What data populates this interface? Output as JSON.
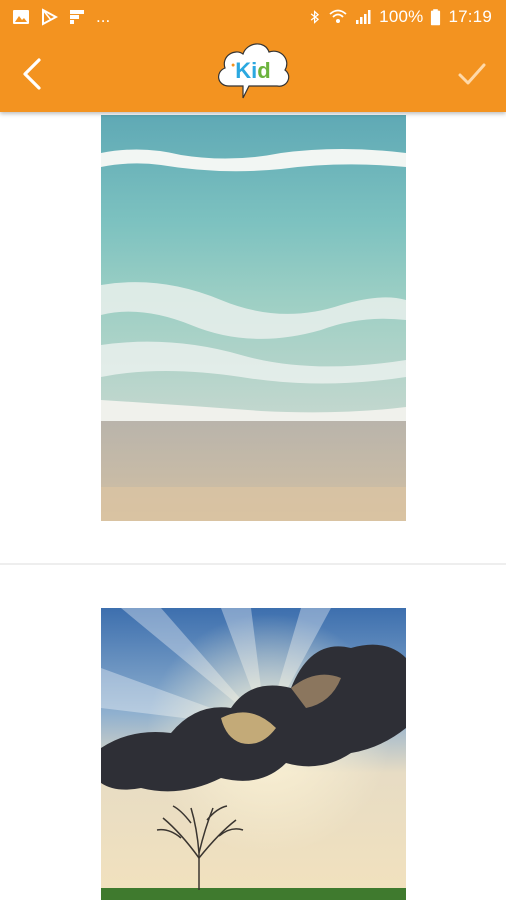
{
  "status_bar": {
    "notification_icons": [
      "image-icon",
      "play-store-icon",
      "flipboard-icon"
    ],
    "overflow_text": "...",
    "battery_text": "100%",
    "time": "17:19",
    "right_icons": [
      "bluetooth-icon",
      "wifi-icon",
      "signal-icon",
      "battery-icon"
    ]
  },
  "toolbar": {
    "back_icon": "chevron-left-icon",
    "logo_text_a": "Ki",
    "logo_text_b": "d",
    "confirm_icon": "check-icon"
  },
  "colors": {
    "app_bar": "#F39320",
    "background": "#FFFFFF",
    "divider": "#EEEEEE"
  },
  "photos": [
    {
      "subject": "beach-waves"
    },
    {
      "subject": "tree-under-clouds-sunbeams"
    }
  ]
}
